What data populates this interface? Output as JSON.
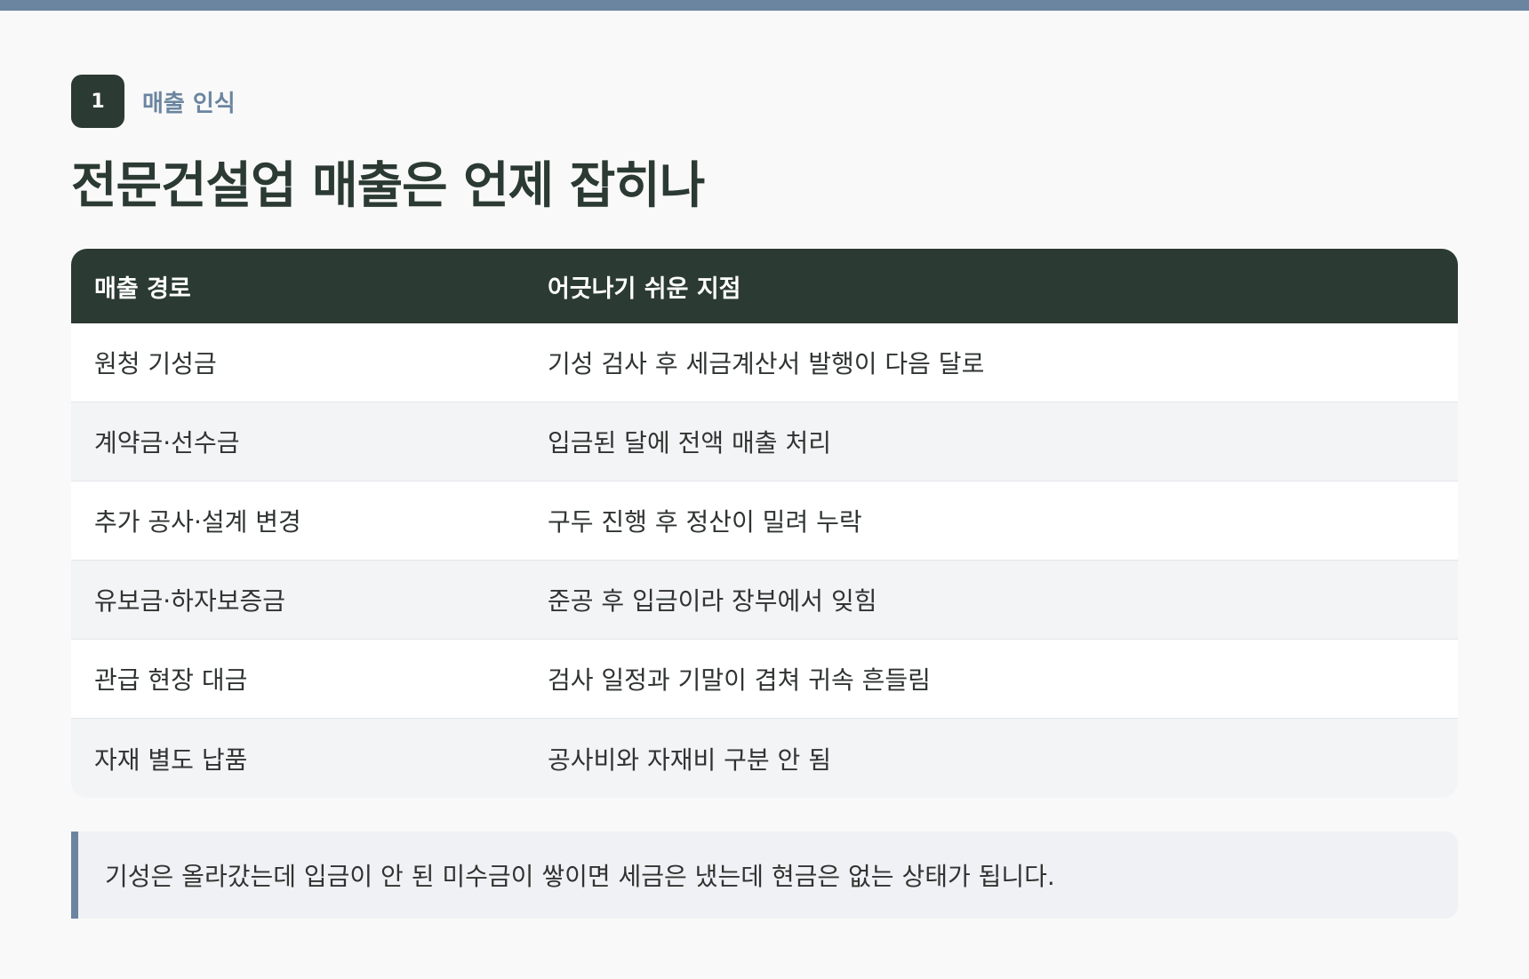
{
  "section": {
    "number": "1",
    "label": "매출 인식"
  },
  "title": "전문건설업 매출은 언제 잡히나",
  "table": {
    "headers": [
      "매출 경로",
      "어긋나기 쉬운 지점"
    ],
    "rows": [
      [
        "원청 기성금",
        "기성 검사 후 세금계산서 발행이 다음 달로"
      ],
      [
        "계약금·선수금",
        "입금된 달에 전액 매출 처리"
      ],
      [
        "추가 공사·설계 변경",
        "구두 진행 후 정산이 밀려 누락"
      ],
      [
        "유보금·하자보증금",
        "준공 후 입금이라 장부에서 잊힘"
      ],
      [
        "관급 현장 대금",
        "검사 일정과 기말이 겹쳐 귀속 흔들림"
      ],
      [
        "자재 별도 납품",
        "공사비와 자재비 구분 안 됨"
      ]
    ]
  },
  "note": "기성은 올라갔는데 입금이 안 된 미수금이 쌓이면 세금은 냈는데 현금은 없는 상태가 됩니다.",
  "colors": {
    "accent": "#6b85a0",
    "dark": "#2b3a33",
    "row_alt": "#f3f4f6",
    "background": "#f9f9f9"
  }
}
